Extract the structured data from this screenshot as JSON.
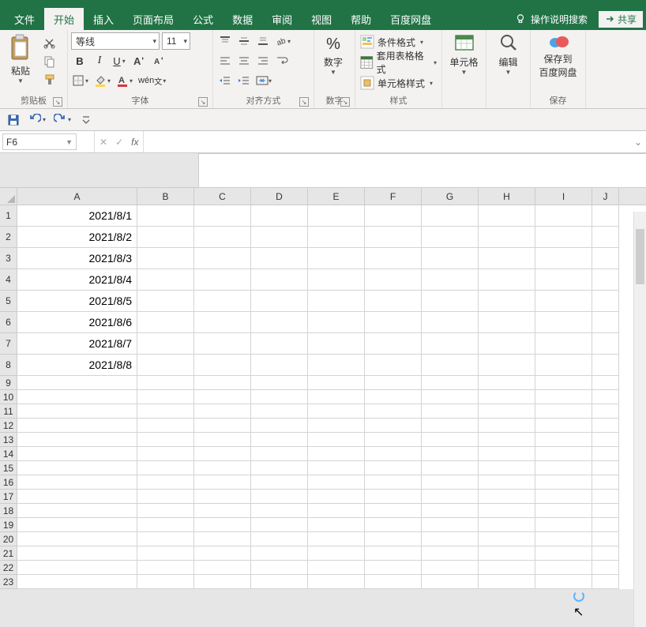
{
  "tabs": {
    "file": "文件",
    "home": "开始",
    "insert": "插入",
    "layout": "页面布局",
    "formula": "公式",
    "data": "数据",
    "review": "审阅",
    "view": "视图",
    "help": "帮助",
    "baidu": "百度网盘",
    "tell_me": "操作说明搜索",
    "share": "共享"
  },
  "ribbon": {
    "clipboard": {
      "paste": "粘贴",
      "label": "剪贴板"
    },
    "font": {
      "name": "等线",
      "size": "11",
      "wen": "wén",
      "label": "字体"
    },
    "align": {
      "label": "对齐方式"
    },
    "number": {
      "pct": "%",
      "btn_label": "数字",
      "label": "数字"
    },
    "styles": {
      "cond": "条件格式",
      "table": "套用表格格式",
      "cell": "单元格样式",
      "label": "样式"
    },
    "cells": {
      "btn": "单元格",
      "label": ""
    },
    "editing": {
      "btn": "编辑",
      "label": ""
    },
    "save": {
      "line1": "保存到",
      "line2": "百度网盘",
      "label": "保存"
    }
  },
  "name_box": "F6",
  "formula": "",
  "columns": [
    "A",
    "B",
    "C",
    "D",
    "E",
    "F",
    "G",
    "H",
    "I",
    "J"
  ],
  "rows": [
    "1",
    "2",
    "3",
    "4",
    "5",
    "6",
    "7",
    "8",
    "9",
    "10",
    "11",
    "12",
    "13",
    "14",
    "15",
    "16",
    "17",
    "18",
    "19",
    "20",
    "21",
    "22",
    "23"
  ],
  "cells": {
    "A1": "2021/8/1",
    "A2": "2021/8/2",
    "A3": "2021/8/3",
    "A4": "2021/8/4",
    "A5": "2021/8/5",
    "A6": "2021/8/6",
    "A7": "2021/8/7",
    "A8": "2021/8/8"
  }
}
